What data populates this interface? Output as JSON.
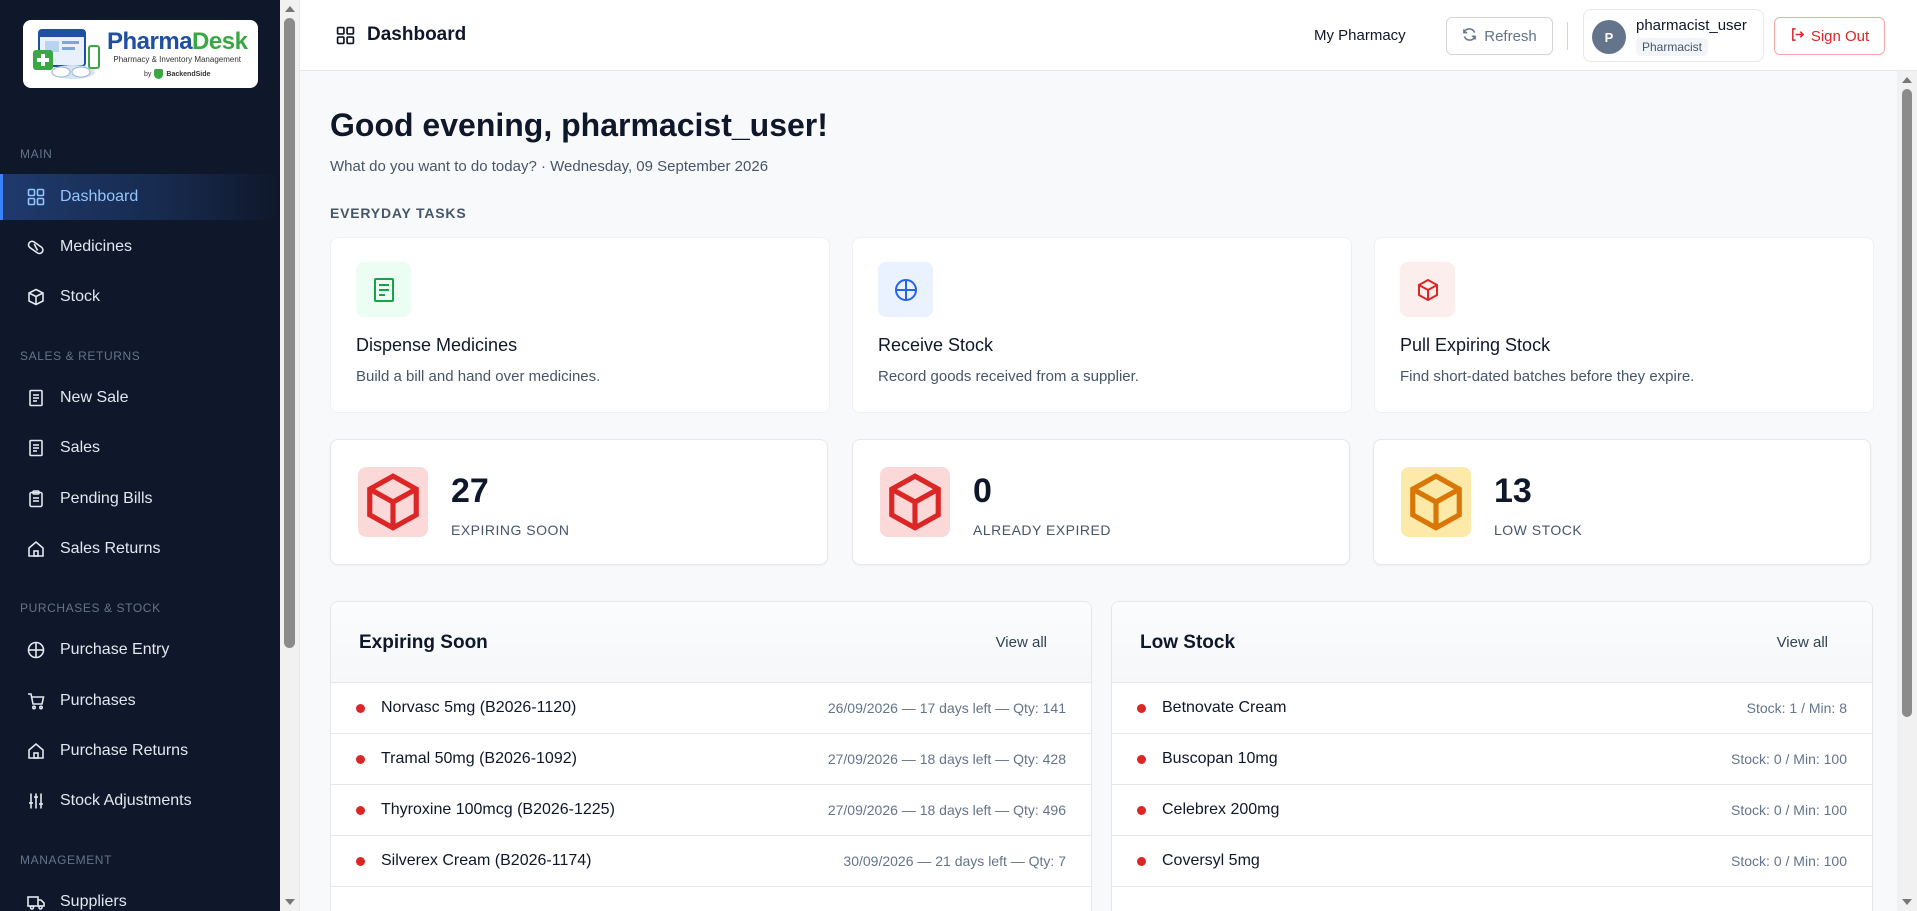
{
  "brand": {
    "name_part1": "Pharma",
    "name_part2": "Desk",
    "tagline": "Pharmacy & Inventory Management",
    "by_prefix": "by",
    "by_company": "BackendSide"
  },
  "sidebar": {
    "sections": [
      {
        "label": "MAIN"
      },
      {
        "label": "SALES & RETURNS"
      },
      {
        "label": "PURCHASES & STOCK"
      },
      {
        "label": "MANAGEMENT"
      }
    ],
    "items": [
      {
        "label": "Dashboard",
        "icon": "grid-icon",
        "active": true
      },
      {
        "label": "Medicines",
        "icon": "pill-icon"
      },
      {
        "label": "Stock",
        "icon": "box-icon"
      },
      {
        "label": "New Sale",
        "icon": "receipt-icon"
      },
      {
        "label": "Sales",
        "icon": "receipt-icon"
      },
      {
        "label": "Pending Bills",
        "icon": "clipboard-icon"
      },
      {
        "label": "Sales Returns",
        "icon": "return-icon"
      },
      {
        "label": "Purchase Entry",
        "icon": "crosshair-icon"
      },
      {
        "label": "Purchases",
        "icon": "cart-icon"
      },
      {
        "label": "Purchase Returns",
        "icon": "return-icon"
      },
      {
        "label": "Stock Adjustments",
        "icon": "sliders-icon"
      },
      {
        "label": "Suppliers",
        "icon": "truck-icon"
      }
    ]
  },
  "header": {
    "title": "Dashboard",
    "pharmacy": "My Pharmacy",
    "refresh_label": "Refresh",
    "user_initial": "P",
    "user_name": "pharmacist_user",
    "user_role": "Pharmacist",
    "signout_label": "Sign Out"
  },
  "main": {
    "greeting": "Good evening, pharmacist_user!",
    "subtitle": "What do you want to do today? · Wednesday, 09 September 2026",
    "tasks_label": "EVERYDAY TASKS",
    "tasks": [
      {
        "title": "Dispense Medicines",
        "desc": "Build a bill and hand over medicines.",
        "icon": "receipt-icon",
        "color": "#16a34a",
        "bg": "#ecfdf3"
      },
      {
        "title": "Receive Stock",
        "desc": "Record goods received from a supplier.",
        "icon": "crosshair-icon",
        "color": "#2563eb",
        "bg": "#eaf2ff"
      },
      {
        "title": "Pull Expiring Stock",
        "desc": "Find short-dated batches before they expire.",
        "icon": "box-icon",
        "color": "#dc2626",
        "bg": "#fdeeee"
      }
    ],
    "stats": [
      {
        "value": "27",
        "label": "EXPIRING SOON",
        "icon": "box-icon",
        "color": "#dc2626",
        "bg": "#fcd9d9"
      },
      {
        "value": "0",
        "label": "ALREADY EXPIRED",
        "icon": "box-icon",
        "color": "#dc2626",
        "bg": "#fcd9d9"
      },
      {
        "value": "13",
        "label": "LOW STOCK",
        "icon": "box-icon",
        "color": "#d97706",
        "bg": "#fdeaa8"
      }
    ],
    "expiring": {
      "title": "Expiring Soon",
      "view_all": "View all",
      "rows": [
        {
          "name": "Norvasc 5mg (B2026-1120)",
          "meta": "26/09/2026 — 17 days left — Qty: 141"
        },
        {
          "name": "Tramal 50mg (B2026-1092)",
          "meta": "27/09/2026 — 18 days left — Qty: 428"
        },
        {
          "name": "Thyroxine 100mcg (B2026-1225)",
          "meta": "27/09/2026 — 18 days left — Qty: 496"
        },
        {
          "name": "Silverex Cream (B2026-1174)",
          "meta": "30/09/2026 — 21 days left — Qty: 7"
        }
      ]
    },
    "lowstock": {
      "title": "Low Stock",
      "view_all": "View all",
      "rows": [
        {
          "name": "Betnovate Cream",
          "meta": "Stock: 1 / Min: 8"
        },
        {
          "name": "Buscopan 10mg",
          "meta": "Stock: 0 / Min: 100"
        },
        {
          "name": "Celebrex 200mg",
          "meta": "Stock: 0 / Min: 100"
        },
        {
          "name": "Coversyl 5mg",
          "meta": "Stock: 0 / Min: 100"
        }
      ]
    }
  }
}
